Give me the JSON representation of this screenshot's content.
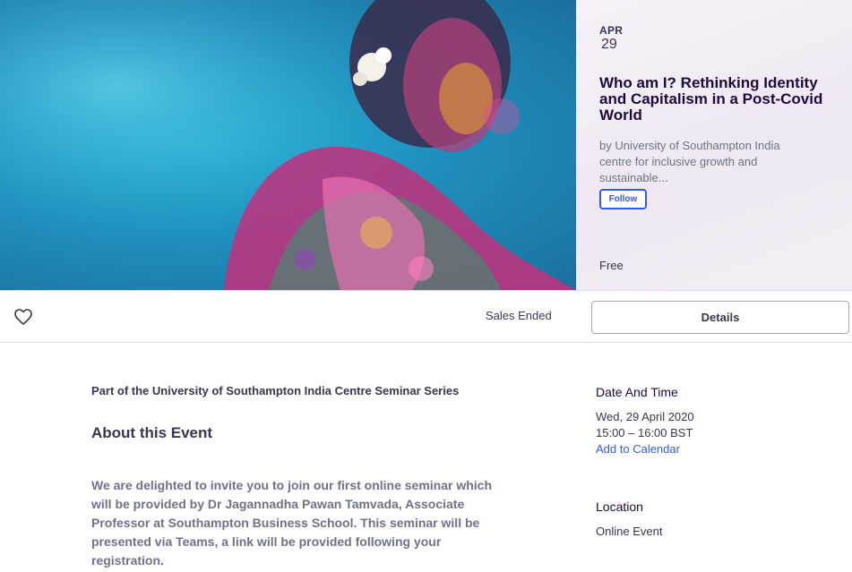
{
  "colors": {
    "accent": "#3659e3",
    "title": "#1e0a3c",
    "text": "#39364f",
    "muted": "#6f7287",
    "border": "#dbdae3"
  },
  "hero": {
    "image_icon": "event-photo",
    "date": {
      "month": "APR",
      "day": "29"
    },
    "title": "Who am I? Rethinking Identity and Capitalism in a Post-Covid World",
    "organizer": "by University of Southampton India centre for inclusive growth and sustainable...",
    "follow_label": "Follow",
    "price": "Free"
  },
  "action_bar": {
    "like_icon": "heart-icon",
    "status": "Sales Ended",
    "details_label": "Details"
  },
  "main": {
    "series": "Part of the University of Southampton India Centre Seminar Series",
    "about_heading": "About this Event",
    "description": "We are delighted to invite you to join our first online seminar which will be provided by Dr Jagannadha Pawan Tamvada, Associate Professor at Southampton Business School. This seminar will be presented via Teams, a link will be provided following your registration."
  },
  "sidebar": {
    "date_heading": "Date And Time",
    "date_value": "Wed, 29 April 2020",
    "time_value": "15:00 – 16:00 BST",
    "add_to_calendar": "Add to Calendar",
    "location_heading": "Location",
    "location_value": "Online Event"
  }
}
